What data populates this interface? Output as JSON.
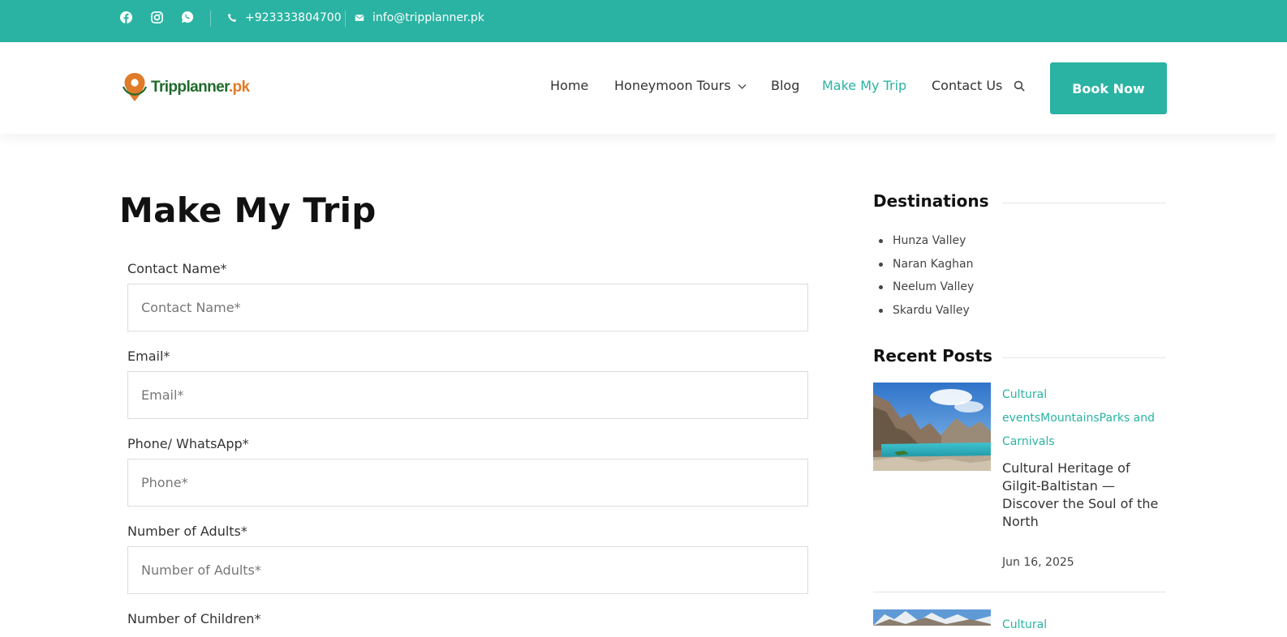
{
  "topbar": {
    "phone": "+923333804700",
    "email": "info@tripplanner.pk",
    "social_icons": [
      "facebook-icon",
      "instagram-icon",
      "whatsapp-icon"
    ],
    "bg_color": "#2ab3a3"
  },
  "header": {
    "logo_text": "Tripplanner",
    "logo_tld": ".pk",
    "nav": [
      {
        "label": "Home"
      },
      {
        "label": "Honeymoon Tours",
        "has_dropdown": true
      },
      {
        "label": "Blog"
      },
      {
        "label": "Make My Trip",
        "active": true
      },
      {
        "label": "Contact Us"
      }
    ],
    "book_now": "Book Now",
    "accent_color": "#2ab3a3"
  },
  "main": {
    "title": "Make My Trip",
    "fields": [
      {
        "label": "Contact Name*",
        "placeholder": "Contact Name*",
        "value": ""
      },
      {
        "label": "Email*",
        "placeholder": "Email*",
        "value": ""
      },
      {
        "label": "Phone/ WhatsApp*",
        "placeholder": "Phone*",
        "value": ""
      },
      {
        "label": "Number of Adults*",
        "placeholder": "Number of Adults*",
        "value": ""
      },
      {
        "label": "Number of Children*"
      }
    ]
  },
  "sidebar": {
    "destinations_heading": "Destinations",
    "destinations": [
      "Hunza Valley",
      "Naran Kaghan",
      "Neelum Valley",
      "Skardu Valley"
    ],
    "recent_heading": "Recent Posts",
    "posts": [
      {
        "category_lines": [
          "Cultural",
          "eventsMountainsParks and",
          "Carnivals"
        ],
        "title": "Cultural Heritage of Gilgit-Baltistan — Discover the Soul of the North",
        "date": "Jun 16, 2025"
      },
      {
        "category_lines": [
          "Cultural"
        ]
      }
    ]
  }
}
